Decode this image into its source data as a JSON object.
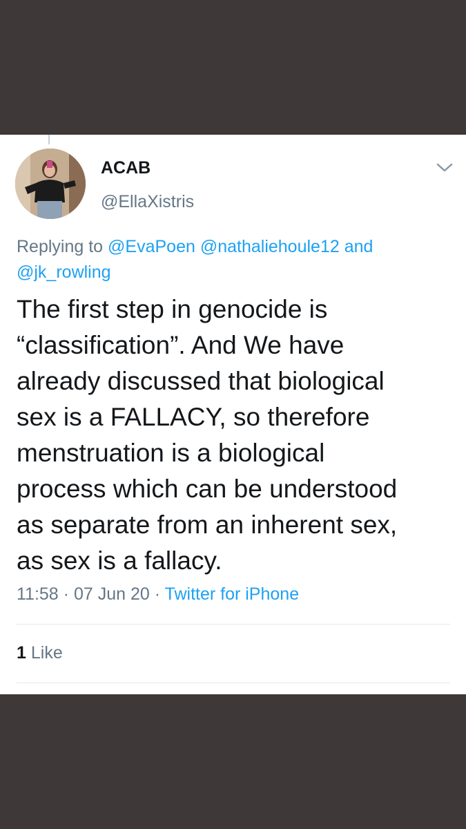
{
  "tweet": {
    "display_name": "ACAB",
    "handle": "@EllaXistris",
    "replying_prefix": "Replying to",
    "replying_mentions_1": "@EvaPoen @nathaliehoule12",
    "replying_and": "and",
    "replying_mentions_2": "@jk_rowling",
    "text_lines": [
      "The first step in genocide is",
      "“classification”. And We have",
      "already discussed that biological",
      "sex is a FALLACY, so therefore",
      "menstruation is a biological",
      "process which can be understood",
      "as separate from an inherent sex,",
      "as sex is a fallacy."
    ],
    "time": "11:58",
    "separator": "·",
    "date": "07 Jun 20",
    "source": "Twitter for iPhone",
    "like_count": "1",
    "like_label": "Like"
  },
  "icons": {
    "menu": "chevron-down-icon",
    "avatar": "profile-photo"
  },
  "colors": {
    "background": "#3f3838",
    "card": "#ffffff",
    "link": "#1da1f2",
    "secondary_text": "#657786",
    "primary_text": "#14171a"
  }
}
